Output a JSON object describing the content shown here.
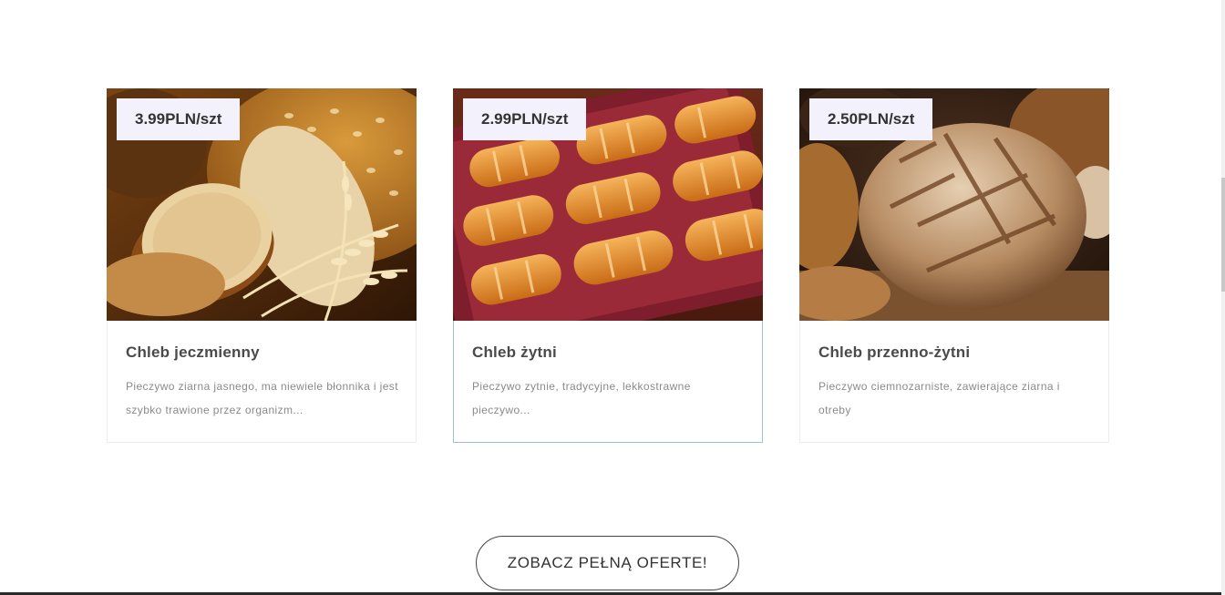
{
  "products": [
    {
      "price": "3.99PLN/szt",
      "title": "Chleb jeczmienny",
      "description": "Pieczywo ziarna jasnego, ma niewiele błonnika i jest szybko trawione przez organizm...",
      "image_icon": "wheat-bread-image"
    },
    {
      "price": "2.99PLN/szt",
      "title": "Chleb żytni",
      "description": "Pieczywo zytnie, tradycyjne, lekkostrawne pieczywo...",
      "image_icon": "bread-rolls-tray-image"
    },
    {
      "price": "2.50PLN/szt",
      "title": "Chleb przenno-żytni",
      "description": "Pieczywo ciemnozarniste, zawierające ziarna i otreby",
      "image_icon": "rustic-loaf-image"
    }
  ],
  "cta": {
    "label": "ZOBACZ PEŁNĄ OFERTE!"
  },
  "colors": {
    "price_badge_bg": "#f3f1fb",
    "active_card_border": "#9fc3d3",
    "text_dark": "#4a4a4a",
    "text_muted": "#8a8a8a"
  }
}
